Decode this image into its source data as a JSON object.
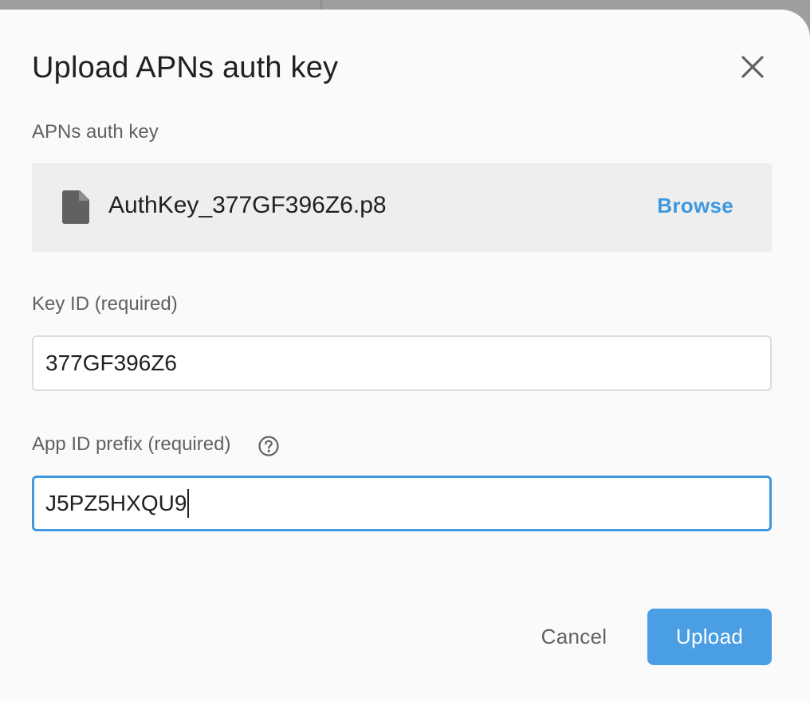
{
  "dialog": {
    "title": "Upload APNs auth key"
  },
  "auth_key": {
    "label": "APNs auth key",
    "file_name": "AuthKey_377GF396Z6.p8",
    "file_icon": "file-icon",
    "browse_label": "Browse"
  },
  "key_id": {
    "label": "Key ID (required)",
    "value": "377GF396Z6"
  },
  "app_id_prefix": {
    "label": "App ID prefix (required)",
    "value": "J5PZ5HXQU9",
    "help_icon": "help-circle-icon"
  },
  "actions": {
    "cancel_label": "Cancel",
    "upload_label": "Upload"
  },
  "colors": {
    "accent": "#3f97dd",
    "primary_button": "#4a9ee3",
    "file_box_bg": "#eeeeee",
    "dialog_bg": "#fafafa"
  }
}
